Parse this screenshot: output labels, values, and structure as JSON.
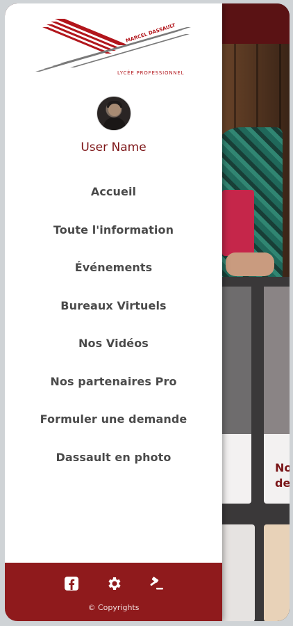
{
  "logo": {
    "top_text": "MARCEL DASSAULT",
    "bottom_text": "LYCÉE PROFESSIONNEL",
    "brand_color": "#b2161c",
    "stripe_color": "#7a7a7a"
  },
  "user": {
    "name": "User Name"
  },
  "menu": {
    "items": [
      {
        "label": "Accueil"
      },
      {
        "label": "Toute l'information"
      },
      {
        "label": "Événements"
      },
      {
        "label": "Bureaux Virtuels"
      },
      {
        "label": "Nos Vidéos"
      },
      {
        "label": "Nos partenaires Pro"
      },
      {
        "label": "Formuler une demande"
      },
      {
        "label": "Dassault en photo"
      }
    ]
  },
  "footer": {
    "icons": [
      "facebook-icon",
      "gear-icon",
      "gavel-icon"
    ],
    "copyright": "© Copyrights",
    "background": "#8f1a1c"
  },
  "background_page": {
    "card_title_partial": "No\nde",
    "accent": "#7a1518"
  }
}
